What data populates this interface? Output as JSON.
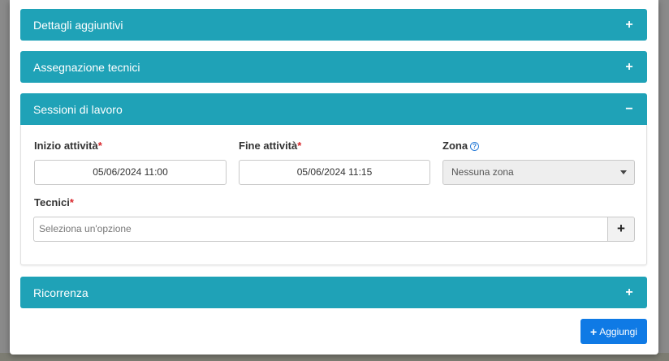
{
  "panels": [
    {
      "title": "Dettagli aggiuntivi",
      "toggle": "+"
    },
    {
      "title": "Assegnazione tecnici",
      "toggle": "+"
    },
    {
      "title": "Sessioni di lavoro",
      "toggle": "−"
    },
    {
      "title": "Ricorrenza",
      "toggle": "+"
    }
  ],
  "sessions": {
    "start": {
      "label": "Inizio attività",
      "required": "*",
      "value": "05/06/2024 11:00"
    },
    "end": {
      "label": "Fine attività",
      "required": "*",
      "value": "05/06/2024 11:15"
    },
    "zone": {
      "label": "Zona",
      "help_icon": "question-circle-icon",
      "value": "Nessuna zona"
    },
    "technicians": {
      "label": "Tecnici",
      "required": "*",
      "placeholder": "Seleziona un'opzione",
      "add_symbol": "+"
    }
  },
  "footer": {
    "add_button_icon": "+",
    "add_button_label": "Aggiungi"
  },
  "colors": {
    "panel_header": "#1fa2b7",
    "primary": "#0f7ae5",
    "required": "#d9262b"
  }
}
